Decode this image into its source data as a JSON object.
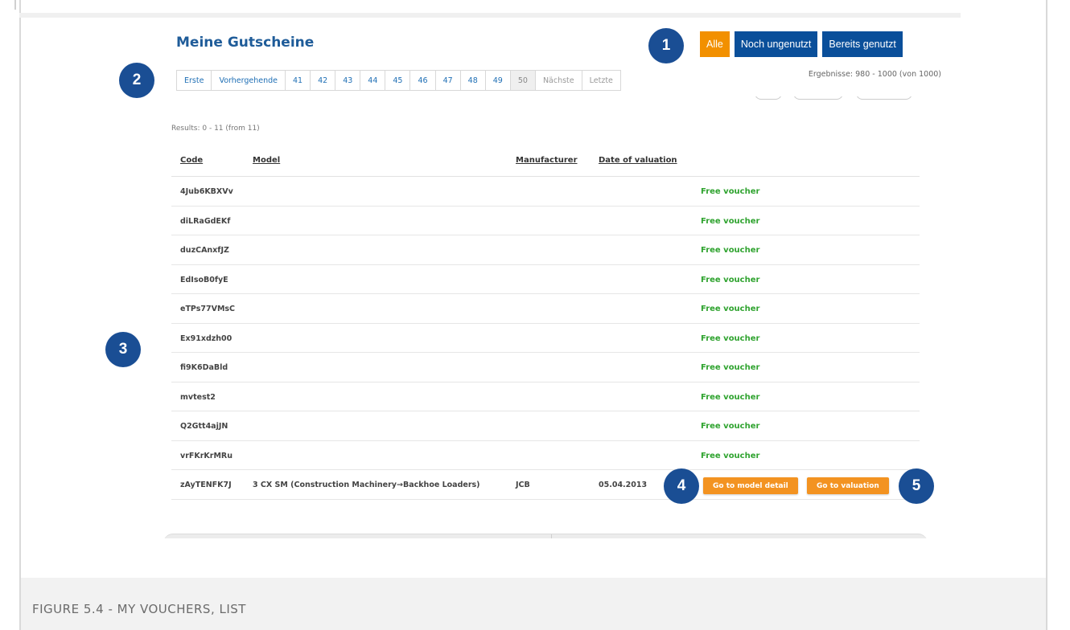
{
  "header": {
    "title": "Meine Gutscheine",
    "results_text": "Ergebnisse: 980 - 1000 (von 1000)"
  },
  "filters": [
    {
      "label": "Alle",
      "active": true
    },
    {
      "label": "Noch ungenutzt",
      "active": false
    },
    {
      "label": "Bereits genutzt",
      "active": false
    }
  ],
  "pagination": {
    "first": "Erste",
    "previous": "Vorhergehende",
    "pages": [
      "41",
      "42",
      "43",
      "44",
      "45",
      "46",
      "47",
      "48",
      "49",
      "50"
    ],
    "current_page": "50",
    "next": "Nächste",
    "last": "Letzte"
  },
  "list": {
    "results_text": "Results: 0 - 11 (from 11)",
    "columns": {
      "code": "Code",
      "model": "Model",
      "manufacturer": "Manufacturer",
      "date": "Date of valuation"
    },
    "rows": [
      {
        "code": "4Jub6KBXVv",
        "status": "Free voucher"
      },
      {
        "code": "diLRaGdEKf",
        "status": "Free voucher"
      },
      {
        "code": "duzCAnxfJZ",
        "status": "Free voucher"
      },
      {
        "code": "EdIsoB0fyE",
        "status": "Free voucher"
      },
      {
        "code": "eTPs77VMsC",
        "status": "Free voucher"
      },
      {
        "code": "Ex91xdzh00",
        "status": "Free voucher"
      },
      {
        "code": "fi9K6DaBld",
        "status": "Free voucher"
      },
      {
        "code": "mvtest2",
        "status": "Free voucher"
      },
      {
        "code": "Q2Gtt4ajJN",
        "status": "Free voucher"
      },
      {
        "code": "vrFKrKrMRu",
        "status": "Free voucher"
      }
    ],
    "last_row": {
      "code": "zAyTENFK7J",
      "model": "3 CX SM (Construction Machinery→Backhoe Loaders)",
      "manufacturer": "JCB",
      "date": "05.04.2013",
      "model_detail_label": "Go to model detail",
      "valuation_label": "Go to valuation"
    }
  },
  "callouts": [
    "1",
    "2",
    "3",
    "4",
    "5"
  ],
  "caption": "FIGURE 5.4 - MY VOUCHERS, LIST",
  "colors": {
    "primary_blue": "#0a4f9a",
    "active_orange": "#f29000",
    "free_green": "#2fa32f",
    "badge_blue": "#1a4e94"
  }
}
